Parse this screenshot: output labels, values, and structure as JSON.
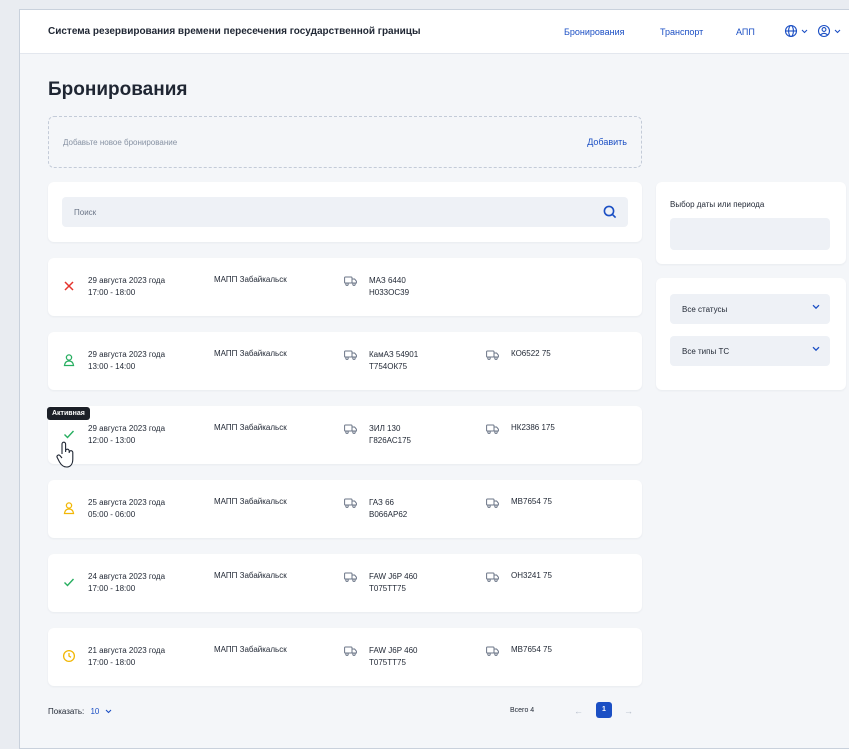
{
  "header": {
    "brand": "Система резервирования времени пересечения государственной границы",
    "nav": [
      "Бронирования",
      "Транспорт",
      "АПП"
    ]
  },
  "page": {
    "title": "Бронирования"
  },
  "add": {
    "placeholder": "Добавьте новое бронирование",
    "button": "Добавить"
  },
  "search": {
    "placeholder": "Поиск"
  },
  "tooltip": "Активная",
  "rows": [
    {
      "status": "x-icon",
      "color": "#e5342d",
      "date": "29 августа 2023 года",
      "time": "17:00 - 18:00",
      "place": "МАПП Забайкальск",
      "vehicle": "МАЗ 6440",
      "plate": "Н033ОС39",
      "trailer": ""
    },
    {
      "status": "person-icon",
      "color": "#27ae60",
      "date": "29 августа 2023 года",
      "time": "13:00 - 14:00",
      "place": "МАПП Забайкальск",
      "vehicle": "КамАЗ 54901",
      "plate": "Т754ОК75",
      "trailer": "КО6522 75"
    },
    {
      "status": "check-icon",
      "color": "#27ae60",
      "date": "29 августа 2023 года",
      "time": "12:00 - 13:00",
      "place": "МАПП Забайкальск",
      "vehicle": "ЗИЛ 130",
      "plate": "Г826АС175",
      "trailer": "НК2386 175"
    },
    {
      "status": "person-icon",
      "color": "#f2b705",
      "date": "25 августа 2023 года",
      "time": "05:00 - 06:00",
      "place": "МАПП Забайкальск",
      "vehicle": "ГАЗ 66",
      "plate": "В066АР62",
      "trailer": "МВ7654 75"
    },
    {
      "status": "check-icon",
      "color": "#27ae60",
      "date": "24 августа 2023 года",
      "time": "17:00 - 18:00",
      "place": "МАПП Забайкальск",
      "vehicle": "FAW J6P 460",
      "plate": "Т075ТТ75",
      "trailer": "ОН3241 75"
    },
    {
      "status": "clock-icon",
      "color": "#f2b705",
      "date": "21 августа 2023 года",
      "time": "17:00 - 18:00",
      "place": "МАПП Забайкальск",
      "vehicle": "FAW J6P 460",
      "plate": "Т075ТТ75",
      "trailer": "МВ7654 75"
    }
  ],
  "side": {
    "date_label": "Выбор даты или периода",
    "status_select": "Все статусы",
    "vehicle_select": "Все типы ТС"
  },
  "footer": {
    "show_label": "Показать:",
    "show_value": "10",
    "total": "Всего 4",
    "current_page": "1"
  }
}
